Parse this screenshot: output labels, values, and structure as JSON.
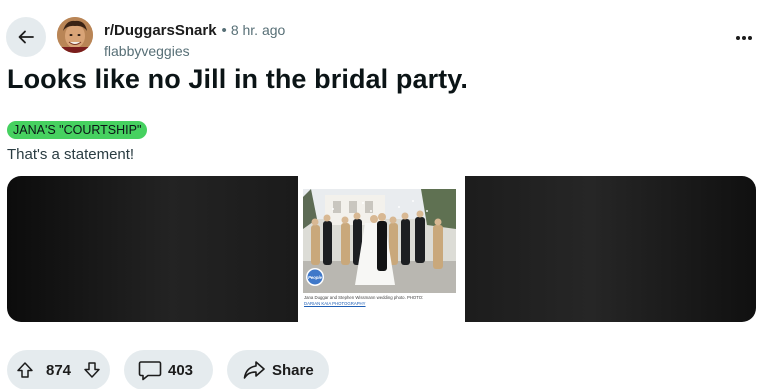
{
  "post": {
    "subreddit": "r/DuggarsSnark",
    "separator": "•",
    "time": "8 hr. ago",
    "username": "flabbyveggies",
    "title": "Looks like no Jill in the bridal party.",
    "flair": "JANA'S \"COURTSHIP\"",
    "flair_color": "#46d160",
    "body": "That's a statement!"
  },
  "media": {
    "publisher_badge": "People",
    "caption": "Jana Duggar and Stephen Wissmann wedding photo. PHOTO:",
    "credit": "DARIAN KAIA PHOTOGRAPHY"
  },
  "actions": {
    "upvote_icon": "arrow-up-icon",
    "downvote_icon": "arrow-down-icon",
    "score": "874",
    "comment_icon": "speech-bubble-icon",
    "comments": "403",
    "share_icon": "share-arrow-icon",
    "share_label": "Share"
  },
  "icons": {
    "back": "arrow-left-icon",
    "more": "ellipsis-icon"
  },
  "colors": {
    "pill_background": "#e5ebee",
    "title": "#0b1416",
    "muted": "#576f76"
  }
}
